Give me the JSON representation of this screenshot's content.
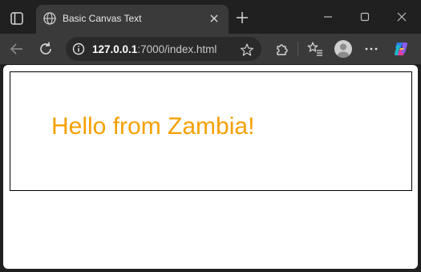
{
  "tab": {
    "title": "Basic Canvas Text"
  },
  "address_bar": {
    "host": "127.0.0.1",
    "rest": ":7000/index.html"
  },
  "canvas": {
    "text": "Hello from Zambia!",
    "text_color": "#f5a000"
  },
  "icons": {
    "tab_actions": "tab-actions-icon",
    "favicon": "globe-icon",
    "close_tab": "close-icon",
    "new_tab": "plus-icon",
    "minimize": "minimize-icon",
    "maximize": "maximize-icon",
    "close_window": "close-icon",
    "back": "back-arrow-icon",
    "refresh": "refresh-icon",
    "site_info": "info-icon",
    "favorite": "star-icon",
    "extensions": "puzzle-icon",
    "favorites": "favorites-list-icon",
    "profile": "profile-icon",
    "more": "more-icon",
    "copilot": "copilot-icon"
  }
}
